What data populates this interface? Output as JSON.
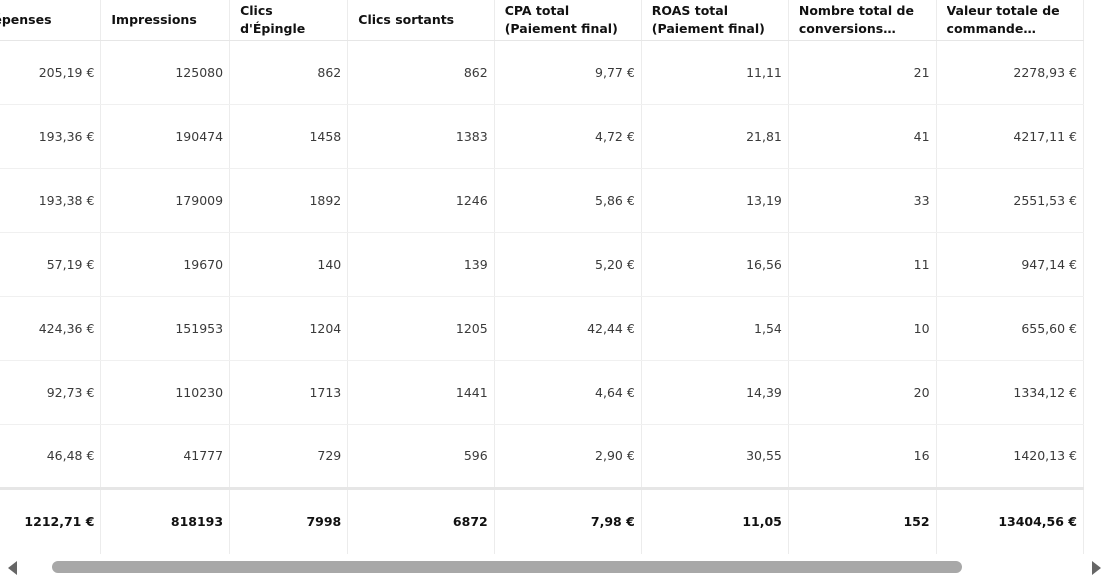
{
  "columns": [
    "Dépenses",
    "Impressions",
    "Clics d'Épingle",
    "Clics sortants",
    "CPA total (Paiement final)",
    "ROAS total (Paiement final)",
    "Nombre total de conversions (Paiement final)",
    "Valeur totale de commande (Paiement final)"
  ],
  "rows": [
    [
      "205,19 €",
      "125080",
      "862",
      "862",
      "9,77 €",
      "11,11",
      "21",
      "2278,93 €"
    ],
    [
      "193,36 €",
      "190474",
      "1458",
      "1383",
      "4,72 €",
      "21,81",
      "41",
      "4217,11 €"
    ],
    [
      "193,38 €",
      "179009",
      "1892",
      "1246",
      "5,86 €",
      "13,19",
      "33",
      "2551,53 €"
    ],
    [
      "57,19 €",
      "19670",
      "140",
      "139",
      "5,20 €",
      "16,56",
      "11",
      "947,14 €"
    ],
    [
      "424,36 €",
      "151953",
      "1204",
      "1205",
      "42,44 €",
      "1,54",
      "10",
      "655,60 €"
    ],
    [
      "92,73 €",
      "110230",
      "1713",
      "1441",
      "4,64 €",
      "14,39",
      "20",
      "1334,12 €"
    ],
    [
      "46,48 €",
      "41777",
      "729",
      "596",
      "2,90 €",
      "30,55",
      "16",
      "1420,13 €"
    ]
  ],
  "totals": [
    "1212,71 €",
    "818193",
    "7998",
    "6872",
    "7,98 €",
    "11,05",
    "152",
    "13404,56 €"
  ],
  "scrollbar": {
    "left_icon": "chevron-left-icon",
    "right_icon": "chevron-right-icon",
    "position_fraction": 0.03,
    "visible_fraction": 0.85
  }
}
